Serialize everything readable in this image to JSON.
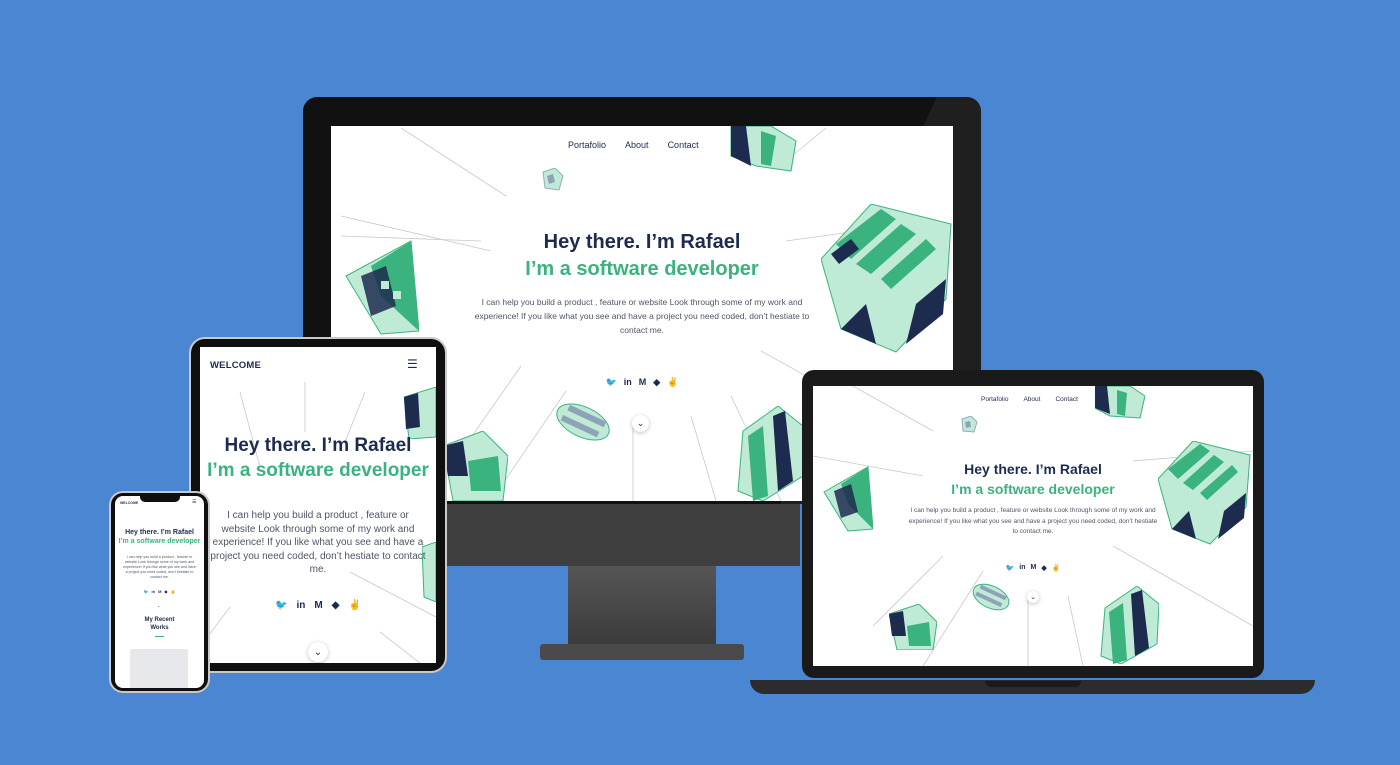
{
  "site": {
    "nav": [
      "Portafolio",
      "About",
      "Contact"
    ],
    "title": "Hey there. I’m Rafael",
    "subtitle": "I’m a software developer",
    "description": "I can help you build a product , feature or website Look through some of my work and experience! If you like what you see and have a project you need coded, don’t hestiate to contact me.",
    "social_icons": [
      "twitter-icon",
      "linkedin-icon",
      "medium-icon",
      "github-icon",
      "angellist-icon"
    ],
    "social_glyphs": [
      "🐦",
      "in",
      "M",
      "◆",
      "✌"
    ],
    "chevron": "⌄",
    "menu_icon": "☰"
  },
  "tablet": {
    "brand": "WELCOME"
  },
  "phone": {
    "brand": "WELCOME",
    "section_title": "My Recent Works"
  },
  "colors": {
    "background": "#4a86d1",
    "navy": "#1d2b4f",
    "green": "#3ab37e",
    "mint": "#bfead6"
  }
}
